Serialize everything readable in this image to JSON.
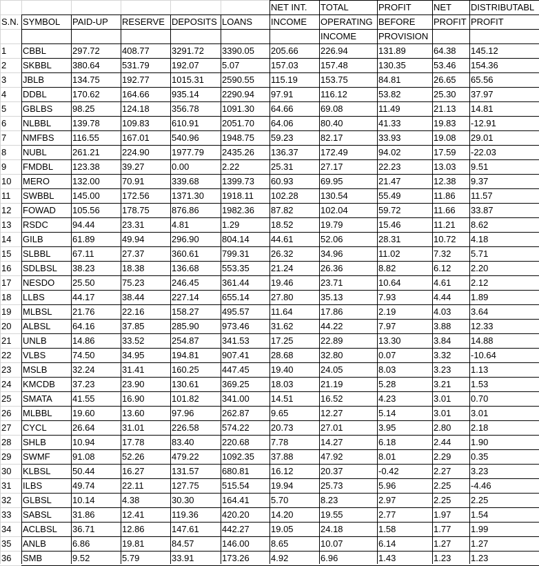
{
  "header": {
    "row1": [
      "",
      "",
      "",
      "",
      "",
      "",
      "NET INT.",
      "TOTAL",
      "PROFIT",
      "NET",
      "DISTRIBUTABL"
    ],
    "row2": [
      "S.N.",
      "SYMBOL",
      "PAID-UP",
      "RESERVE",
      "DEPOSITS",
      "LOANS",
      "INCOME",
      "OPERATING",
      "BEFORE",
      "PROFIT",
      "PROFIT"
    ],
    "row3": [
      "",
      "",
      "",
      "",
      "",
      "",
      "",
      "INCOME",
      "PROVISION",
      "",
      ""
    ]
  },
  "rows": [
    [
      "1",
      "CBBL",
      "297.72",
      "408.77",
      "3291.72",
      "3390.05",
      "205.66",
      "226.94",
      "131.89",
      "64.38",
      "145.12"
    ],
    [
      "2",
      "SKBBL",
      "380.64",
      "531.79",
      "192.07",
      "5.07",
      "157.03",
      "157.48",
      "130.35",
      "53.46",
      "154.36"
    ],
    [
      "3",
      "JBLB",
      "134.75",
      "192.77",
      "1015.31",
      "2590.55",
      "115.19",
      "153.75",
      "84.81",
      "26.65",
      "65.56"
    ],
    [
      "4",
      "DDBL",
      "170.62",
      "164.66",
      "935.14",
      "2290.94",
      "97.91",
      "116.12",
      "53.82",
      "25.30",
      "37.97"
    ],
    [
      "5",
      "GBLBS",
      "98.25",
      "124.18",
      "356.78",
      "1091.30",
      "64.66",
      "69.08",
      "11.49",
      "21.13",
      "14.81"
    ],
    [
      "6",
      "NLBBL",
      "139.78",
      "109.83",
      "610.91",
      "2051.70",
      "64.06",
      "80.40",
      "41.33",
      "19.83",
      "-12.91"
    ],
    [
      "7",
      "NMFBS",
      "116.55",
      "167.01",
      "540.96",
      "1948.75",
      "59.23",
      "82.17",
      "33.93",
      "19.08",
      "29.01"
    ],
    [
      "8",
      "NUBL",
      "261.21",
      "224.90",
      "1977.79",
      "2435.26",
      "136.37",
      "172.49",
      "94.02",
      "17.59",
      "-22.03"
    ],
    [
      "9",
      "FMDBL",
      "123.38",
      "39.27",
      "0.00",
      "2.22",
      "25.31",
      "27.17",
      "22.23",
      "13.03",
      "9.51"
    ],
    [
      "10",
      "MERO",
      "132.00",
      "70.91",
      "339.68",
      "1399.73",
      "60.93",
      "69.95",
      "21.47",
      "12.38",
      "9.37"
    ],
    [
      "11",
      "SWBBL",
      "145.00",
      "172.56",
      "1371.30",
      "1918.11",
      "102.28",
      "130.54",
      "55.49",
      "11.86",
      "11.57"
    ],
    [
      "12",
      "FOWAD",
      "105.56",
      "178.75",
      "876.86",
      "1982.36",
      "87.82",
      "102.04",
      "59.72",
      "11.66",
      "33.87"
    ],
    [
      "13",
      "RSDC",
      "94.44",
      "23.31",
      "4.81",
      "1.29",
      "18.52",
      "19.79",
      "15.46",
      "11.21",
      "8.62"
    ],
    [
      "14",
      "GILB",
      "61.89",
      "49.94",
      "296.90",
      "804.14",
      "44.61",
      "52.06",
      "28.31",
      "10.72",
      "4.18"
    ],
    [
      "15",
      "SLBBL",
      "67.11",
      "27.37",
      "360.61",
      "799.31",
      "26.32",
      "34.96",
      "11.02",
      "7.32",
      "5.71"
    ],
    [
      "16",
      "SDLBSL",
      "38.23",
      "18.38",
      "136.68",
      "553.35",
      "21.24",
      "26.36",
      "8.82",
      "6.12",
      "2.20"
    ],
    [
      "17",
      "NESDO",
      "25.50",
      "75.23",
      "246.45",
      "361.44",
      "19.46",
      "23.71",
      "10.64",
      "4.61",
      "2.12"
    ],
    [
      "18",
      "LLBS",
      "44.17",
      "38.44",
      "227.14",
      "655.14",
      "27.80",
      "35.13",
      "7.93",
      "4.44",
      "1.89"
    ],
    [
      "19",
      "MLBSL",
      "21.76",
      "22.16",
      "158.27",
      "495.57",
      "11.64",
      "17.86",
      "2.19",
      "4.03",
      "3.64"
    ],
    [
      "20",
      "ALBSL",
      "64.16",
      "37.85",
      "285.90",
      "973.46",
      "31.62",
      "44.22",
      "7.97",
      "3.88",
      "12.33"
    ],
    [
      "21",
      "UNLB",
      "14.86",
      "33.52",
      "254.87",
      "341.53",
      "17.25",
      "22.89",
      "13.30",
      "3.84",
      "14.88"
    ],
    [
      "22",
      "VLBS",
      "74.50",
      "34.95",
      "194.81",
      "907.41",
      "28.68",
      "32.80",
      "0.07",
      "3.32",
      "-10.64"
    ],
    [
      "23",
      "MSLB",
      "32.24",
      "31.41",
      "160.25",
      "447.45",
      "19.40",
      "24.05",
      "8.03",
      "3.23",
      "1.13"
    ],
    [
      "24",
      "KMCDB",
      "37.23",
      "23.90",
      "130.61",
      "369.25",
      "18.03",
      "21.19",
      "5.28",
      "3.21",
      "1.53"
    ],
    [
      "25",
      "SMATA",
      "41.55",
      "16.90",
      "101.82",
      "341.00",
      "14.51",
      "16.52",
      "4.23",
      "3.01",
      "0.70"
    ],
    [
      "26",
      "MLBBL",
      "19.60",
      "13.60",
      "97.96",
      "262.87",
      "9.65",
      "12.27",
      "5.14",
      "3.01",
      "3.01"
    ],
    [
      "27",
      "CYCL",
      "26.64",
      "31.01",
      "226.58",
      "574.22",
      "20.73",
      "27.01",
      "3.95",
      "2.80",
      "2.18"
    ],
    [
      "28",
      "SHLB",
      "10.94",
      "17.78",
      "83.40",
      "220.68",
      "7.78",
      "14.27",
      "6.18",
      "2.44",
      "1.90"
    ],
    [
      "29",
      "SWMF",
      "91.08",
      "52.26",
      "479.22",
      "1092.35",
      "37.88",
      "47.92",
      "8.01",
      "2.29",
      "0.35"
    ],
    [
      "30",
      "KLBSL",
      "50.44",
      "16.27",
      "131.57",
      "680.81",
      "16.12",
      "20.37",
      "-0.42",
      "2.27",
      "3.23"
    ],
    [
      "31",
      "ILBS",
      "49.74",
      "22.11",
      "127.75",
      "515.54",
      "19.94",
      "25.73",
      "5.96",
      "2.25",
      "-4.46"
    ],
    [
      "32",
      "GLBSL",
      "10.14",
      "4.38",
      "30.30",
      "164.41",
      "5.70",
      "8.23",
      "2.97",
      "2.25",
      "2.25"
    ],
    [
      "33",
      "SABSL",
      "31.86",
      "12.41",
      "119.36",
      "420.20",
      "14.20",
      "19.55",
      "2.77",
      "1.97",
      "1.54"
    ],
    [
      "34",
      "ACLBSL",
      "36.71",
      "12.86",
      "147.61",
      "442.27",
      "19.05",
      "24.18",
      "1.58",
      "1.77",
      "1.99"
    ],
    [
      "35",
      "ANLB",
      "6.86",
      "19.81",
      "84.57",
      "146.00",
      "8.65",
      "10.07",
      "6.14",
      "1.27",
      "1.27"
    ],
    [
      "36",
      "SMB",
      "9.52",
      "5.79",
      "33.91",
      "173.26",
      "4.92",
      "6.96",
      "1.43",
      "1.23",
      "1.23"
    ]
  ]
}
